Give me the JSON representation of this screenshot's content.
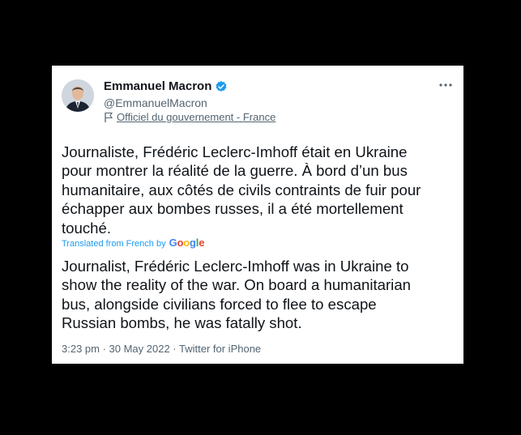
{
  "tweet": {
    "author_name": "Emmanuel Macron",
    "author_handle": "@EmmanuelMacron",
    "affiliation": "Officiel du gouvernement - France",
    "text_original": "Journaliste, Frédéric Leclerc-Imhoff était en Ukraine\npour montrer la réalité de la guerre. À bord d’un bus\nhumanitaire, aux côtés de civils contraints de fuir pour\néchapper aux bombes russes, il a été mortellement\ntouché.",
    "translated_label": "Translated from French by",
    "translator_logo_text": "Google",
    "text_translated": "Journalist, Frédéric Leclerc-Imhoff was in Ukraine to\nshow the reality of the war. On board a humanitarian\nbus, alongside civilians forced to flee to escape\nRussian bombs, he was fatally shot.",
    "timestamp_line": "3:23 pm · 30 May 2022 · Twitter for iPhone"
  },
  "icons": {
    "verified": "verified-badge-icon",
    "affiliation": "flag-icon",
    "more": "more-options-icon"
  },
  "colors": {
    "background": "#000000",
    "card": "#ffffff",
    "text": "#0f1419",
    "secondary_text": "#536471",
    "verified_blue": "#1d9bf0",
    "link_blue": "#1d9bf0"
  }
}
